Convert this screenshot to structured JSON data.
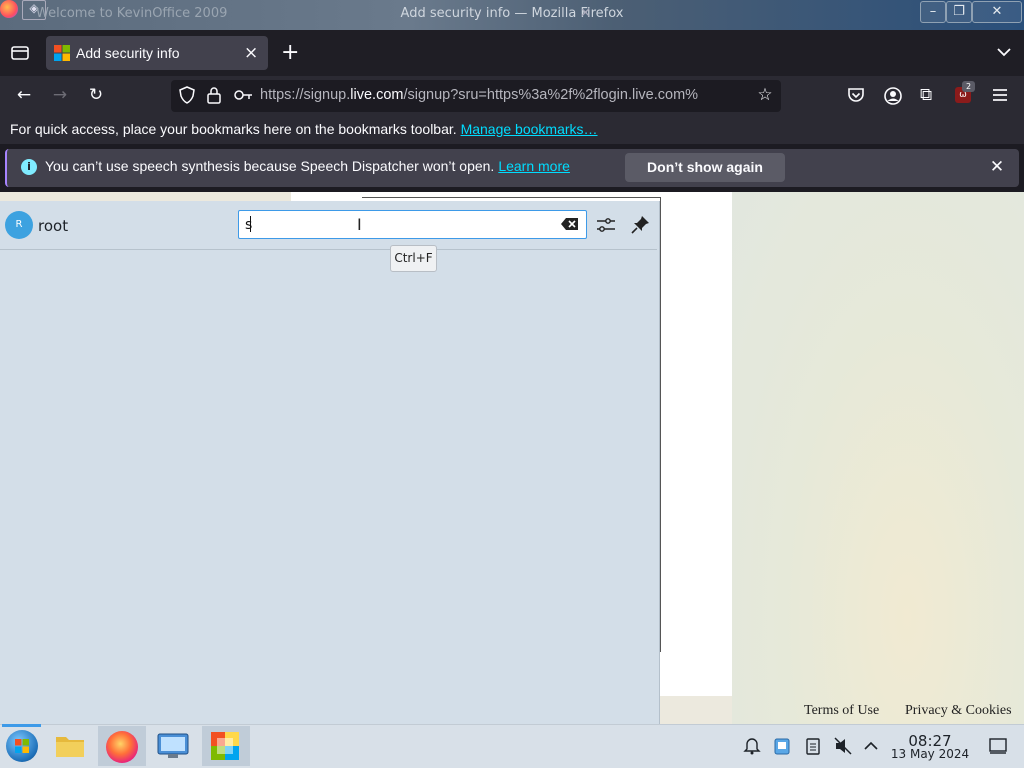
{
  "window": {
    "title": "Add security info — Mozilla Firefox",
    "background_window_title": "Welcome to KevinOffice 2009",
    "buttons": {
      "minimize": "–",
      "maximize": "❐",
      "close": "✕"
    }
  },
  "tabs": {
    "active_title": "Add security info",
    "new_tab_label": "+",
    "close_label": "×"
  },
  "urlbar": {
    "url_prefix": "https://signup.",
    "url_domain": "live.com",
    "url_suffix": "/signup?sru=https%3a%2f%2flogin.live.com%",
    "extension_badge": "2"
  },
  "bookmarks_bar": {
    "text": "For quick access, place your bookmarks here on the bookmarks toolbar.",
    "link": "Manage bookmarks…"
  },
  "notification": {
    "text": "You can’t use speech synthesis because Speech Dispatcher won’t open.",
    "learn_more": "Learn more",
    "button": "Don’t show again",
    "icon": "info-icon"
  },
  "launcher": {
    "user_initial": "R",
    "user_name": "root",
    "search_value": "s",
    "shortcut_tooltip": "Ctrl+F"
  },
  "page": {
    "footer_terms": "Terms of Use",
    "footer_privacy": "Privacy & Cookies"
  },
  "taskbar": {
    "apps": [
      "start-menu",
      "file-manager",
      "firefox",
      "control-panel",
      "kevinoffice"
    ],
    "clock_time": "08:27",
    "clock_date": "13 May 2024",
    "accent": "#3d9ae8"
  }
}
